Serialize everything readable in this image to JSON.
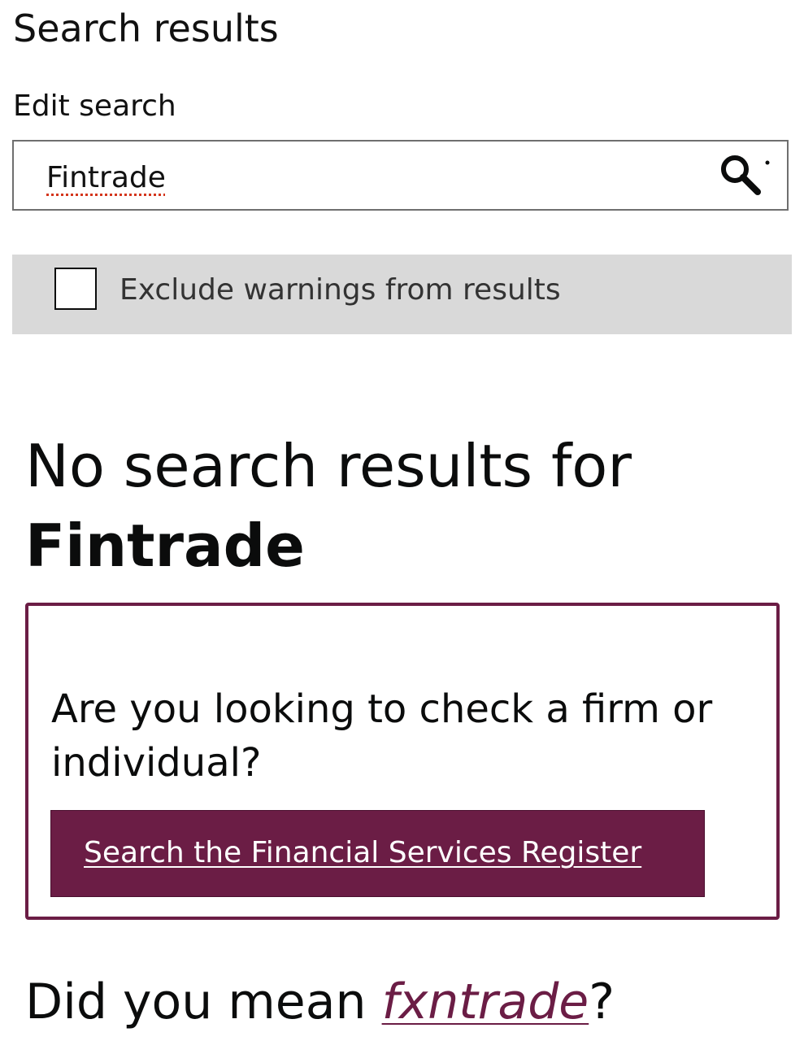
{
  "header": {
    "title": "Search results"
  },
  "search": {
    "label": "Edit search",
    "value": "Fintrade",
    "button_icon": "search-icon"
  },
  "filter": {
    "checkbox_label": "Exclude warnings from results",
    "checked": false
  },
  "results": {
    "no_results_text": "No search results for",
    "query": "Fintrade"
  },
  "callout": {
    "question": "Are you looking to check a firm or individual?",
    "button_label": "Search the Financial Services Register"
  },
  "suggestion": {
    "prefix": "Did you mean ",
    "term": "fxntrade",
    "suffix": "?"
  },
  "colors": {
    "accent": "#6b1d45",
    "filter_background": "#d9d9d9",
    "text": "#0b0c0c"
  }
}
